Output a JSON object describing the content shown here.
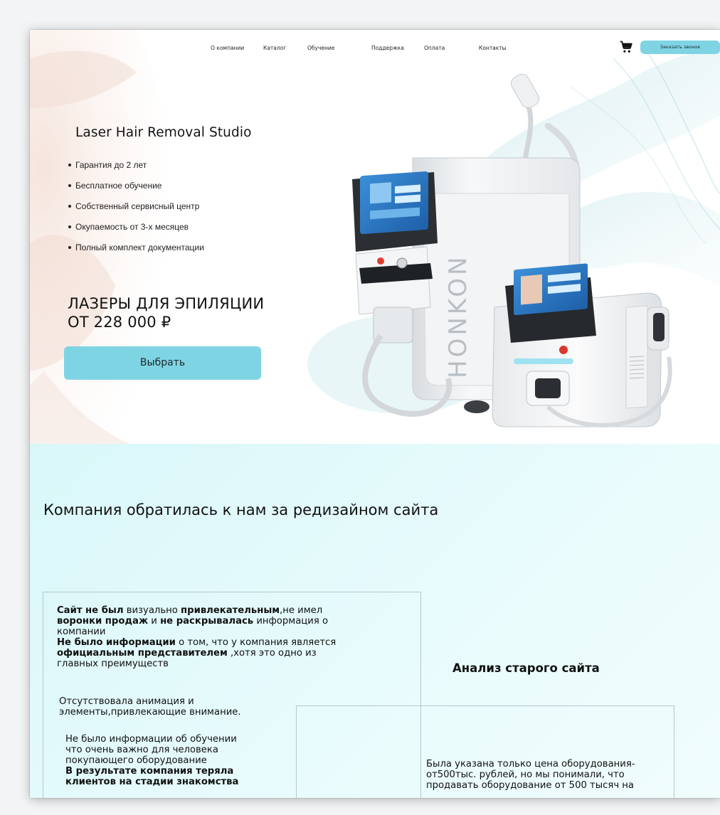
{
  "nav": {
    "items": [
      "О компании",
      "Каталог",
      "Обучение",
      "Поддержка",
      "Оплата",
      "Контакты"
    ],
    "call_button": "Заказать звонок"
  },
  "hero": {
    "studio_title": "Laser Hair Removal Studio",
    "features": [
      "Гарантия до 2 лет",
      "Бесплатное обучение",
      "Собственный сервисный центр",
      "Окупаемость от 3-х месяцев",
      "Полный комплект документации"
    ],
    "headline_line1": "ЛАЗЕРЫ ДЛЯ ЭПИЛЯЦИИ",
    "headline_line2": "ОТ 228 000 ₽",
    "cta": "Выбрать",
    "brand_text": "HONKON"
  },
  "case": {
    "heading": "Компания обратилась к нам за редизайном сайта",
    "analysis_title": "Анализ старого сайта",
    "left_p1": {
      "s1": "Сайт не был",
      "s2": " визуально ",
      "s3": "привлекательным",
      "s4": ",не имел",
      "s5": "воронки продаж",
      "s6": " и ",
      "s7": "не раскрывалась",
      "s8": " информация о",
      "s9": "компании",
      "s10": "Не было информации",
      "s11": " о том, что у компания является",
      "s12": "официальным представителем",
      "s13": " ,хотя это одно из",
      "s14": "главных преимуществ"
    },
    "left_p2": {
      "l1": "Отсутствовала анимация и",
      "l2": "элементы,привлекающие внимание."
    },
    "left_p3": {
      "l1": "Не было информации об обучении",
      "l2": "что очень важно для человека",
      "l3": "покупающего оборудование",
      "l4": "В результате компания теряла",
      "l5": "клиентов на стадии знакомства"
    },
    "right_p1": {
      "l1": "Была указана только цена оборудования-",
      "l2": "от500тыс. рублей, но мы понимали, что",
      "l3": "продавать оборудование от 500 тысяч на"
    }
  },
  "colors": {
    "accent": "#7fd4e4",
    "section_bg": "#e2f9fa",
    "border": "#b7c7cb"
  },
  "icons": [
    "cart-icon"
  ]
}
